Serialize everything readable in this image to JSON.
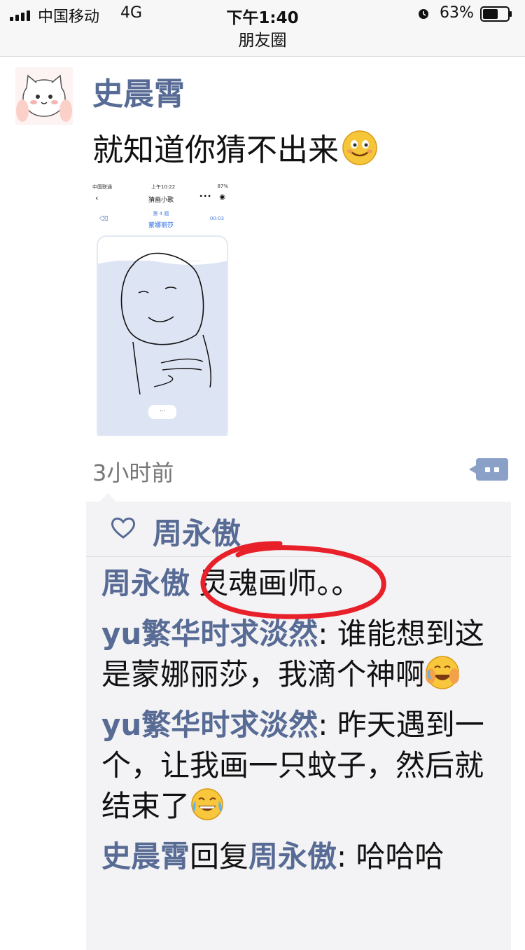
{
  "status_bar": {
    "carrier": "中国移动",
    "network": "4G",
    "time": "下午1:40",
    "battery": "63%",
    "battery_level": 0.63
  },
  "nav": {
    "title": "朋友圈"
  },
  "post": {
    "author": "史晨霄",
    "text": "就知道你猜不出来",
    "text_emoji": "smile-emoji",
    "time_ago": "3小时前",
    "embedded_screenshot": {
      "status_left": "中国联通",
      "status_time": "上午10:22",
      "status_right": "87%",
      "title": "猜画小歌",
      "menu": "•••",
      "round": "第 4 题",
      "answer": "蒙娜丽莎",
      "timer": "00:03",
      "bubble": "..."
    }
  },
  "likes": {
    "names": "周永傲",
    "icon": "heart-icon"
  },
  "comments": [
    {
      "name": "周永傲",
      "text": " 灵魂画师。。"
    },
    {
      "name": "yu繁华时求淡然",
      "text": ": 谁能想到这是蒙娜丽莎，我滴个神啊",
      "emoji": "facepalm-laugh-emoji"
    },
    {
      "name": "yu繁华时求淡然",
      "text": ": 昨天遇到一个，让我画一只蚊子，然后就结束了",
      "emoji": "tears-of-joy-emoji"
    },
    {
      "name": "史晨霄",
      "reply_word": "回复",
      "reply_to": "周永傲",
      "text": ": 哈哈哈"
    }
  ],
  "colors": {
    "link": "#576b95",
    "panel_bg": "#f3f3f5",
    "annotation_circle": "#e8202a"
  }
}
